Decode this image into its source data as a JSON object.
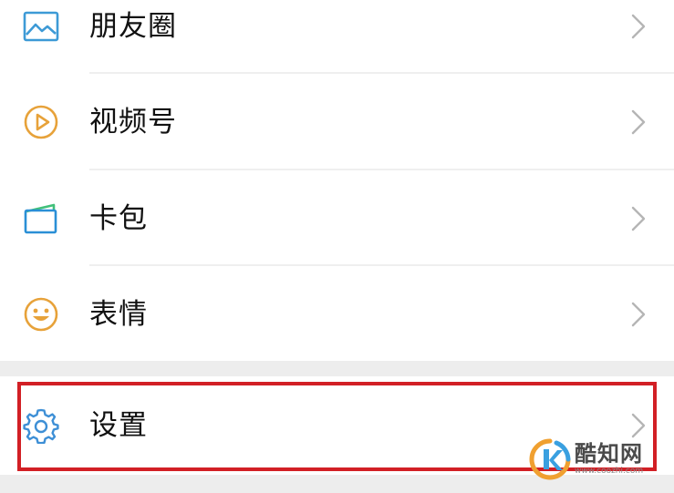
{
  "menu": {
    "items": [
      {
        "label": "朋友圈",
        "icon": "moments-image-icon"
      },
      {
        "label": "视频号",
        "icon": "channels-play-icon"
      },
      {
        "label": "卡包",
        "icon": "card-wallet-icon"
      },
      {
        "label": "表情",
        "icon": "sticker-smile-icon"
      }
    ],
    "settings": {
      "label": "设置",
      "icon": "gear-icon"
    }
  },
  "watermark": {
    "title": "酷知网",
    "url": "www.coozhi.com"
  },
  "colors": {
    "moments_icon": "#3d9ad6",
    "channels_icon": "#e7a23a",
    "card_icon": "#2a8fd6",
    "card_accent": "#41c07a",
    "sticker_icon": "#e7a23a",
    "settings_icon": "#3d8fd6",
    "highlight": "#d21f25"
  }
}
